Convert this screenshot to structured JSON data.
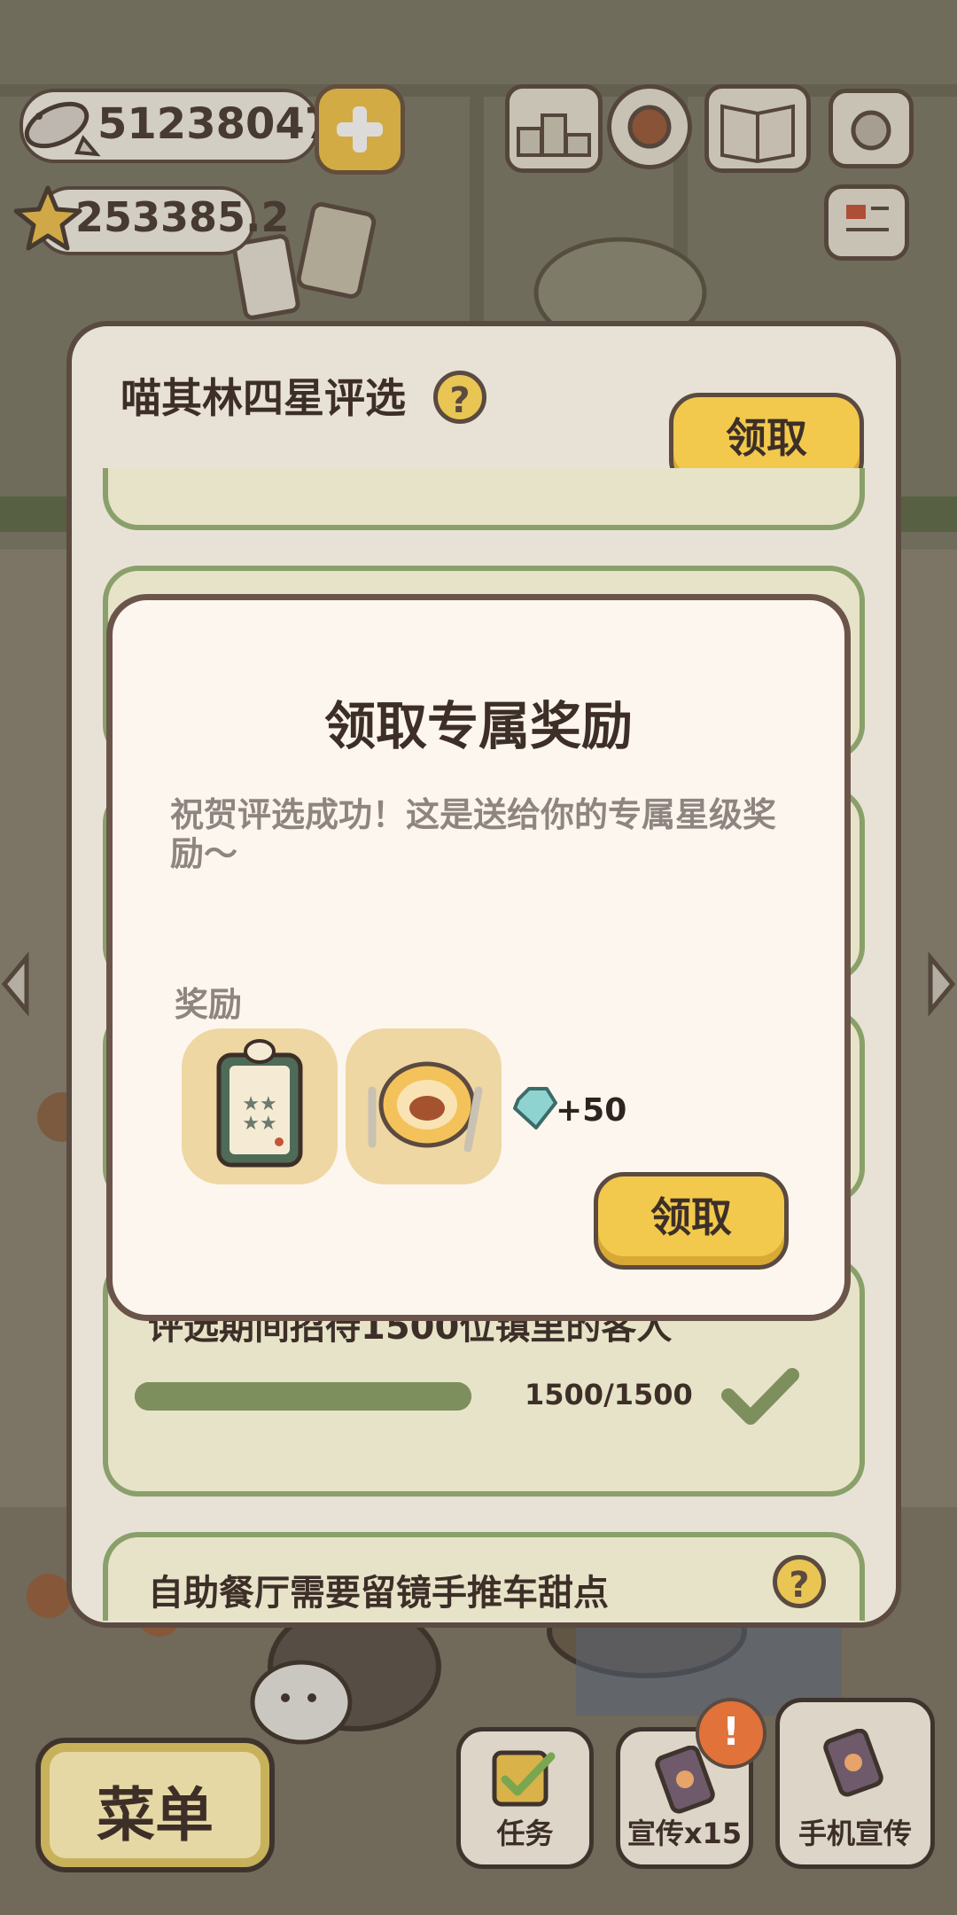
{
  "hud": {
    "fish_amount": "512380477",
    "star_amount": "253385.2"
  },
  "panel": {
    "title": "喵其林四星评选",
    "claim_label": "领取",
    "task": {
      "text": "评选期间招待1500位镇里的客人",
      "progress_text": "1500/1500",
      "progress_fraction": 1.0
    },
    "next_task_partial": "自助餐厅需要留镜手推车甜点"
  },
  "modal": {
    "title": "领取专属奖励",
    "description": "祝贺评选成功！这是送给你的专属星级奖励～",
    "reward_label": "奖励",
    "rewards": [
      {
        "icon": "chef-board-icon"
      },
      {
        "icon": "paw-plate-icon"
      }
    ],
    "gem_count": "+50",
    "claim_button": "领取"
  },
  "bottom_bar": {
    "menu": "菜单",
    "tasks": "任务",
    "promote": "宣传x15",
    "phone_promote": "手机宣传",
    "badge": "!"
  }
}
